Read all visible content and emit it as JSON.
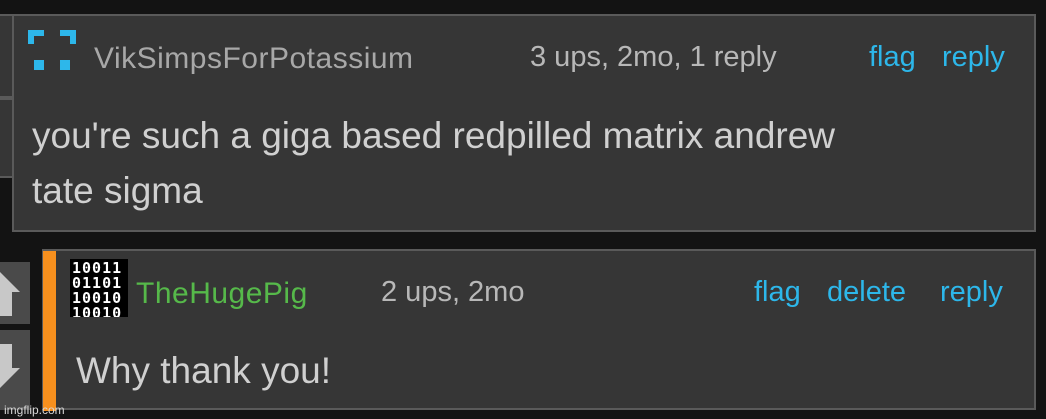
{
  "comments": [
    {
      "username": "VikSimpsForPotassium",
      "username_color": "#a8a8a8",
      "meta": "3 ups, 2mo, 1 reply",
      "actions": [
        "flag",
        "reply"
      ],
      "body_lines": [
        "you're such a giga based redpilled matrix andrew",
        "tate sigma"
      ]
    },
    {
      "username": "TheHugePig",
      "username_color": "#56b94a",
      "meta": "2 ups, 2mo",
      "actions": [
        "flag",
        "delete",
        "reply"
      ],
      "body_lines": [
        "Why thank you!"
      ]
    }
  ],
  "avatar2_binary": [
    "10011",
    "01101",
    "10010",
    "10010"
  ],
  "watermark": "imgflip.com",
  "colors": {
    "accent": "#2db7ea",
    "orange": "#f7901e",
    "green": "#56b94a"
  }
}
